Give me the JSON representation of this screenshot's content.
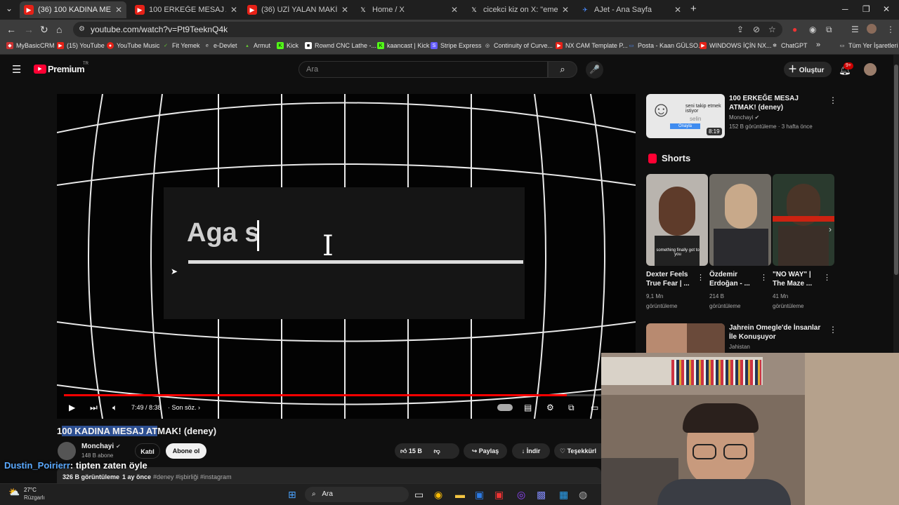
{
  "tabs": [
    {
      "title": "(36) 100 KADINA MESAJ ATMA",
      "active": true
    },
    {
      "title": "100 ERKEĞE MESAJ ATMAK! (de",
      "active": false
    },
    {
      "title": "(36) UZİ YALAN MAKİNESİNDE",
      "active": false
    },
    {
      "title": "Home / X",
      "active": false
    },
    {
      "title": "cicekci kiz on X: \"emenike bu ne",
      "active": false
    },
    {
      "title": "AJet - Ana Sayfa",
      "active": false
    }
  ],
  "address": {
    "url": "youtube.com/watch?v=Pt9TeeknQ4k"
  },
  "bookmarks": [
    "MyBasicCRM",
    "(15) YouTube",
    "YouTube Music",
    "Fit Yemek",
    "e-Devlet",
    "Armut",
    "Kick",
    "Rownd CNC Lathe -...",
    "kaancast | Kick",
    "Stripe Express",
    "Continuity of Curve...",
    "NX CAM Template P...",
    "Posta - Kaan GÜLSO...",
    "WINDOWS İÇİN NX...",
    "ChatGPT",
    "»",
    "Tüm Yer İşaretleri"
  ],
  "yt": {
    "logo": "Premium",
    "logo_sup": "TR",
    "search_placeholder": "Ara",
    "create": "Oluştur",
    "notif_badge": "9+"
  },
  "video": {
    "overlay_text": "Aga s",
    "progress": 0.89,
    "time": "7:49 / 8:38",
    "chapter": "Son söz.",
    "title_highlight": "00 KADINA MESAJ AT",
    "title_prefix": "1",
    "title_suffix": "MAK! (deney)"
  },
  "channel": {
    "name": "Monchayi",
    "subs": "148 B abone",
    "join": "Katıl",
    "subscribe": "Abone ol",
    "likes": "15 B",
    "share": "Paylaş",
    "download": "İndir",
    "thanks": "Teşekkürl",
    "views_line": "326 B görüntüleme",
    "date": "1 ay önce",
    "tags": "#deney #işbirliği #instagram"
  },
  "chat": {
    "user": "Dustin_Poirierr",
    "message": ": tipten zaten öyle"
  },
  "sidebar": {
    "rec1": {
      "title": "100 ERKEĞE MESAJ ATMAK! (deney)",
      "channel": "Monchayi",
      "meta": "152 B görüntüleme · 3 hafta önce",
      "duration": "8:19",
      "thumb_top": "seni takip etmek istiyor",
      "thumb_name": "selin",
      "thumb_btn": "Onayla"
    },
    "shorts_label": "Shorts",
    "shorts": [
      {
        "title": "Dexter Feels True Fear | ...",
        "views": "9,1 Mn",
        "unit": "görüntüleme",
        "caption": "something finally got to you"
      },
      {
        "title": "Özdemir Erdoğan - ...",
        "views": "214 B",
        "unit": "görüntüleme",
        "caption": ""
      },
      {
        "title": "\"NO WAY\" | The Maze ...",
        "views": "41 Mn",
        "unit": "görüntüleme",
        "caption": ""
      }
    ],
    "rec2": {
      "title": "Jahrein Omegle'de İnsanlar İle Konuşuyor",
      "channel": "Jahistan"
    }
  },
  "taskbar": {
    "temp": "27°C",
    "weather": "Rüzgarlı",
    "search": "Ara"
  }
}
